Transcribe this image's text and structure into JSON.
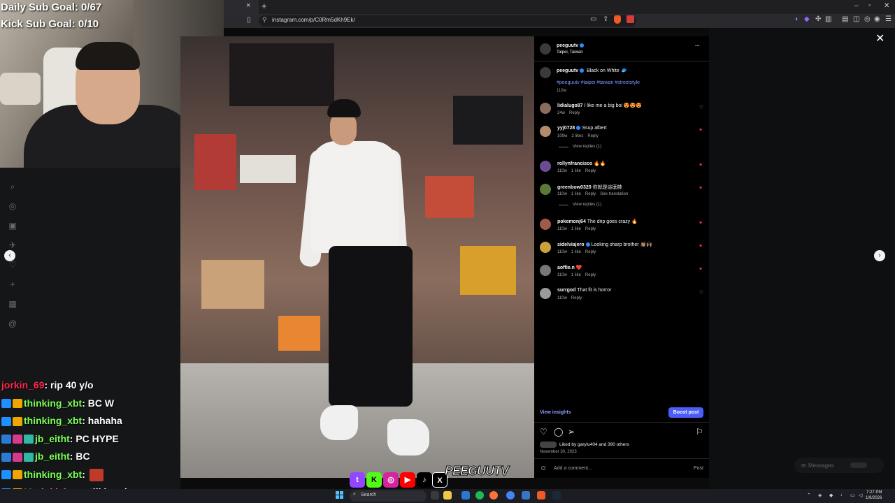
{
  "stream": {
    "daily_goal": "Daily Sub Goal: 0/67",
    "kick_goal": "Kick Sub Goal: 0/10"
  },
  "browser": {
    "url": "instagram.com/p/C0Rm5dKh9Ek/",
    "close_tab": "×",
    "new_tab": "+",
    "minimize": "–",
    "maximize": "▫",
    "close_window": "✕"
  },
  "post": {
    "username": "peeguutv",
    "location": "Taipei, Taiwan",
    "caption": "Black on White 🧢",
    "hashtags": "#peeguutv #taipei #taiwan #streetstyle",
    "caption_time": "110w",
    "more_icon": "···",
    "comments": [
      {
        "user": "lidialugo87",
        "text": "I like me a big boi 😍😍😍",
        "time": "24w",
        "likes": "",
        "reply": "Reply",
        "liked": false,
        "view_replies": "",
        "translation": "",
        "verified": false
      },
      {
        "user": "yyj0728",
        "text": "Ssup albert",
        "time": "109w",
        "likes": "2 likes",
        "reply": "Reply",
        "liked": true,
        "view_replies": "View replies (1)",
        "translation": "",
        "verified": true
      },
      {
        "user": "rollynfrancisco",
        "text": "🔥🔥",
        "time": "110w",
        "likes": "1 like",
        "reply": "Reply",
        "liked": true,
        "view_replies": "",
        "translation": "",
        "verified": false
      },
      {
        "user": "greenbow0320",
        "text": "你就是這麼帥",
        "time": "110w",
        "likes": "1 like",
        "reply": "Reply",
        "liked": true,
        "view_replies": "View replies (1)",
        "translation": "See translation",
        "verified": false
      },
      {
        "user": "pokemonj64",
        "text": "The drip goes crazy 🔥",
        "time": "110w",
        "likes": "1 like",
        "reply": "Reply",
        "liked": true,
        "view_replies": "",
        "translation": "",
        "verified": false
      },
      {
        "user": "sidelviajero",
        "text": "Looking sharp brother 👏🏽🙌🏽",
        "time": "110w",
        "likes": "1 like",
        "reply": "Reply",
        "liked": true,
        "view_replies": "",
        "translation": "",
        "verified": true
      },
      {
        "user": "aoffie.n",
        "text": "❤️",
        "time": "110w",
        "likes": "1 like",
        "reply": "Reply",
        "liked": true,
        "view_replies": "",
        "translation": "",
        "verified": false
      },
      {
        "user": "surrgod",
        "text": "That fit is horror",
        "time": "110w",
        "likes": "",
        "reply": "Reply",
        "liked": false,
        "view_replies": "",
        "translation": "",
        "verified": false
      }
    ],
    "view_insights": "View insights",
    "boost_post": "Boost post",
    "liked_by": "Liked by garylu404 and 390 others",
    "date": "November 30, 2023",
    "add_comment_placeholder": "Add a comment...",
    "post_button": "Post",
    "nav_prev": "‹",
    "nav_next": "›",
    "close_x": "✕",
    "messages": "Messages"
  },
  "chat": [
    {
      "user": "jorkin_69",
      "msg": ": rip 40 y/o",
      "color": "#ff2a4a",
      "badges": []
    },
    {
      "user": "thinking_xbt",
      "msg": ": BC W",
      "color": "#7bff57",
      "badges": [
        "#1e90ff",
        "#f0a500"
      ]
    },
    {
      "user": "thinking_xbt",
      "msg": ": hahaha",
      "color": "#7bff57",
      "badges": [
        "#1e90ff",
        "#f0a500"
      ]
    },
    {
      "user": "jb_eitht",
      "msg": ": PC HYPE",
      "color": "#7bff57",
      "badges": [
        "#2a7bd6",
        "#d63a8a",
        "#2fb7a8"
      ]
    },
    {
      "user": "jb_eitht",
      "msg": ": BC",
      "color": "#7bff57",
      "badges": [
        "#2a7bd6",
        "#d63a8a",
        "#2fb7a8"
      ]
    },
    {
      "user": "thinking_xbt",
      "msg": ":",
      "color": "#7bff57",
      "badges": [
        "#1e90ff",
        "#f0a500"
      ]
    },
    {
      "user": "Marjokleinn",
      "msg": ": still handsome",
      "color": "#ff6aa3",
      "badges": [
        "#1e90ff",
        "#f0a500"
      ]
    }
  ],
  "overlay": {
    "logo": "PEEGUUTV"
  },
  "taskbar": {
    "search": "Search",
    "time": "7:27 PM",
    "date": "1/9/2026"
  },
  "colors": {
    "instagram_blue": "#4a5df9",
    "like_red": "#ff3040",
    "link_blue": "#8aa2ff"
  }
}
